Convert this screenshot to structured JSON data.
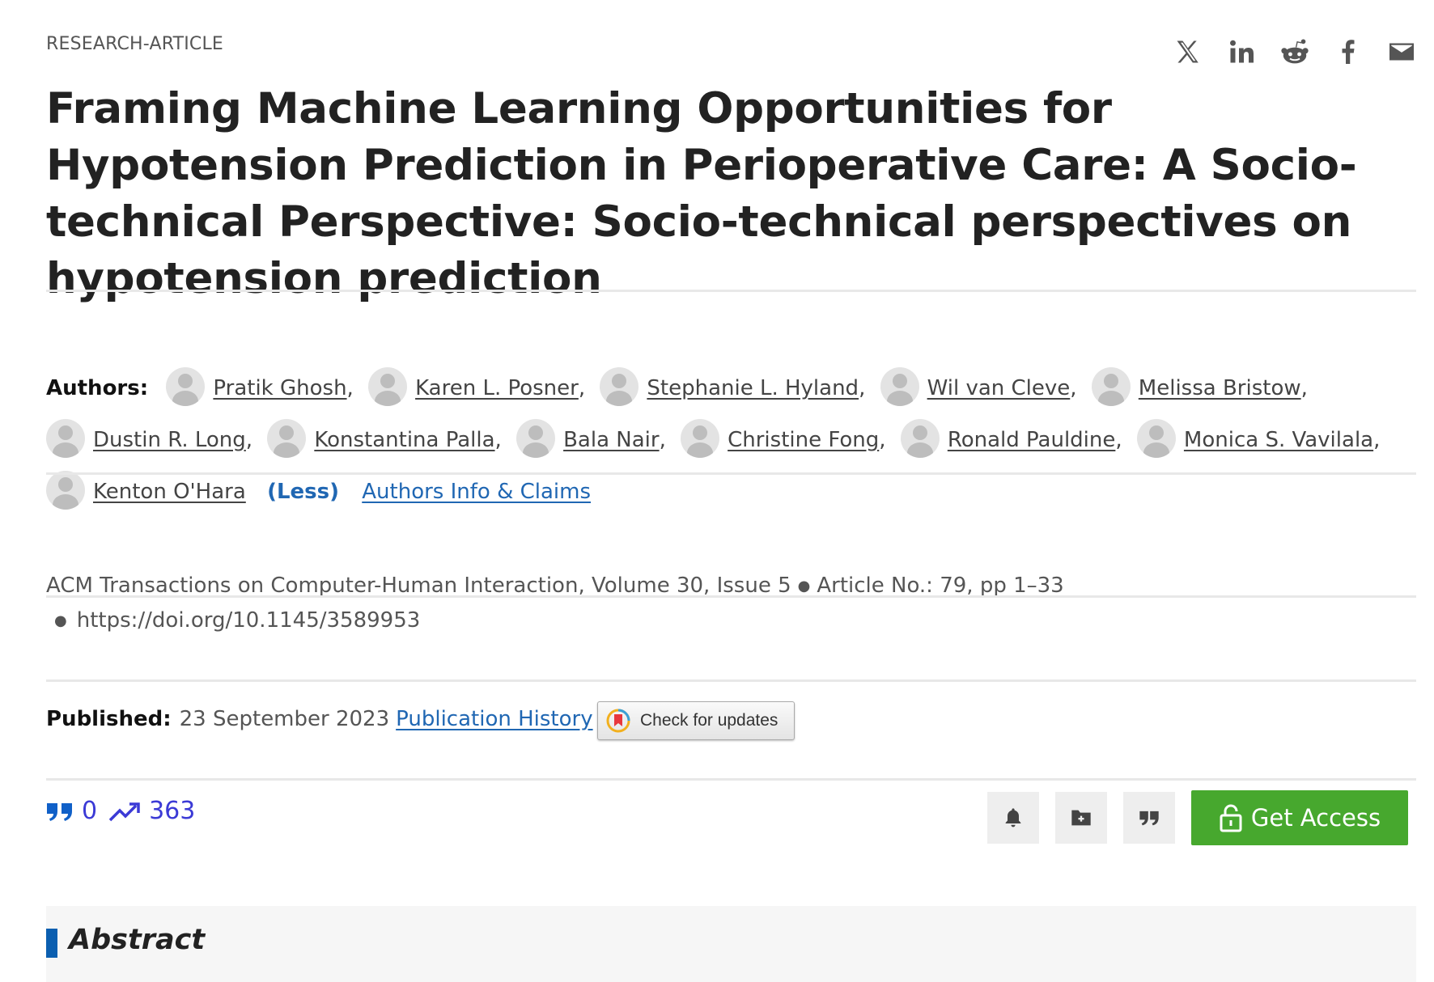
{
  "article_type": "RESEARCH-ARTICLE",
  "share": {
    "icons": [
      "x-icon",
      "linkedin-icon",
      "reddit-icon",
      "facebook-icon",
      "email-icon"
    ]
  },
  "title": "Framing Machine Learning Opportunities for Hypotension Prediction in Perioperative Care: A Socio-technical Perspective: Socio-technical perspectives on hypotension prediction",
  "authors_section": {
    "label": "Authors:",
    "authors": [
      "Pratik Ghosh",
      "Karen L. Posner",
      "Stephanie L. Hyland",
      "Wil van Cleve",
      "Melissa Bristow",
      "Dustin R. Long",
      "Konstantina Palla",
      "Bala Nair",
      "Christine Fong",
      "Ronald Pauldine",
      "Monica S. Vavilala",
      "Kenton O'Hara"
    ],
    "separator": ",",
    "less_label": "(Less)",
    "info_link": "Authors Info & Claims"
  },
  "citation": {
    "journal": "ACM Transactions on Computer-Human Interaction",
    "volume": "Volume 30",
    "issue": "Issue 5",
    "article_no": "Article No.: 79",
    "pages": "pp 1–33",
    "doi": "https://doi.org/10.1145/3589953"
  },
  "published": {
    "label": "Published:",
    "date": "23 September 2023",
    "history_link": "Publication History",
    "check_updates": "Check for updates"
  },
  "metrics": {
    "citations": "0",
    "downloads": "363",
    "color": "#3b3ad6"
  },
  "actions": {
    "icons": [
      "bell-icon",
      "folder-add-icon",
      "quote-icon"
    ],
    "get_access": "Get Access",
    "get_access_color": "#47a82e"
  },
  "abstract": {
    "heading": "Abstract",
    "accent_color": "#0b5fb0"
  }
}
